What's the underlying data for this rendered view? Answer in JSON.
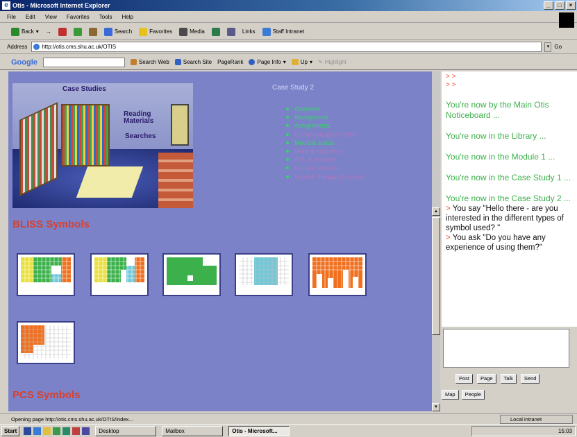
{
  "window": {
    "title": "Otis - Microsoft Internet Explorer"
  },
  "menu": [
    "File",
    "Edit",
    "View",
    "Favorites",
    "Tools",
    "Help"
  ],
  "toolbar": {
    "back": "Back",
    "search": "Search",
    "favorites": "Favorites",
    "media": "Media",
    "links": "Links",
    "staff_intranet": "Staff Intranet"
  },
  "address": {
    "label": "Address",
    "url": "http://otis.cms.shu.ac.uk/OTIS",
    "go": "Go"
  },
  "google": {
    "logo": "Google",
    "search_web": "Search Web",
    "search_site": "Search Site",
    "pagerank": "PageRank",
    "page_info": "Page Info",
    "up": "Up",
    "highlight": "Highlight"
  },
  "scene": {
    "case_studies": "Case Studies",
    "reading_materials": "Reading Materials",
    "searches": "Searches"
  },
  "case_study": {
    "title": "Case Study 2",
    "links": [
      {
        "label": "Overview",
        "color": "#3cd070"
      },
      {
        "label": "Background",
        "color": "#3cd070"
      },
      {
        "label": "Assignments",
        "color": "#3cd070"
      },
      {
        "label": "Communications chart",
        "color": "#b07ac0"
      },
      {
        "label": "Medical status",
        "color": "#3cd070"
      },
      {
        "label": "Skills & cognition",
        "color": "#b07ac0"
      },
      {
        "label": "ADL & hobbies",
        "color": "#b07ac0"
      },
      {
        "label": "Current situation",
        "color": "#b07ac0"
      },
      {
        "label": "Speech therapist's report",
        "color": "#b07ac0"
      }
    ]
  },
  "sections": {
    "bliss": "BLISS Symbols",
    "pcs": "PCS Symbols"
  },
  "chat": {
    "arrow_lines": [
      "> >",
      "> >"
    ],
    "locations": [
      "You're now by the Main Otis Noticeboard ...",
      "You're now in the Library ...",
      "You're now in the Module 1 ...",
      "You're now in the Case Study 1 ...",
      "You're now in the Case Study 2 ..."
    ],
    "messages": [
      {
        "marker": ">",
        "text": "You say \"Hello there - are you interested in the different types of symbol used? \""
      },
      {
        "marker": ">",
        "text": "You ask \"Do you have any experience of using them?\""
      }
    ],
    "buttons": [
      "Post",
      "Page",
      "Talk",
      "Send"
    ],
    "map_button": "Map",
    "people_button": "People"
  },
  "status": {
    "text": "Opening page http://otis.cms.shu.ac.uk/OTIS/index...",
    "zone": "Local intranet"
  },
  "taskbar": {
    "start": "Start",
    "tasks": [
      "Desktop",
      "Mailbox",
      "Otis - Microsoft..."
    ],
    "clock": "15:03"
  }
}
